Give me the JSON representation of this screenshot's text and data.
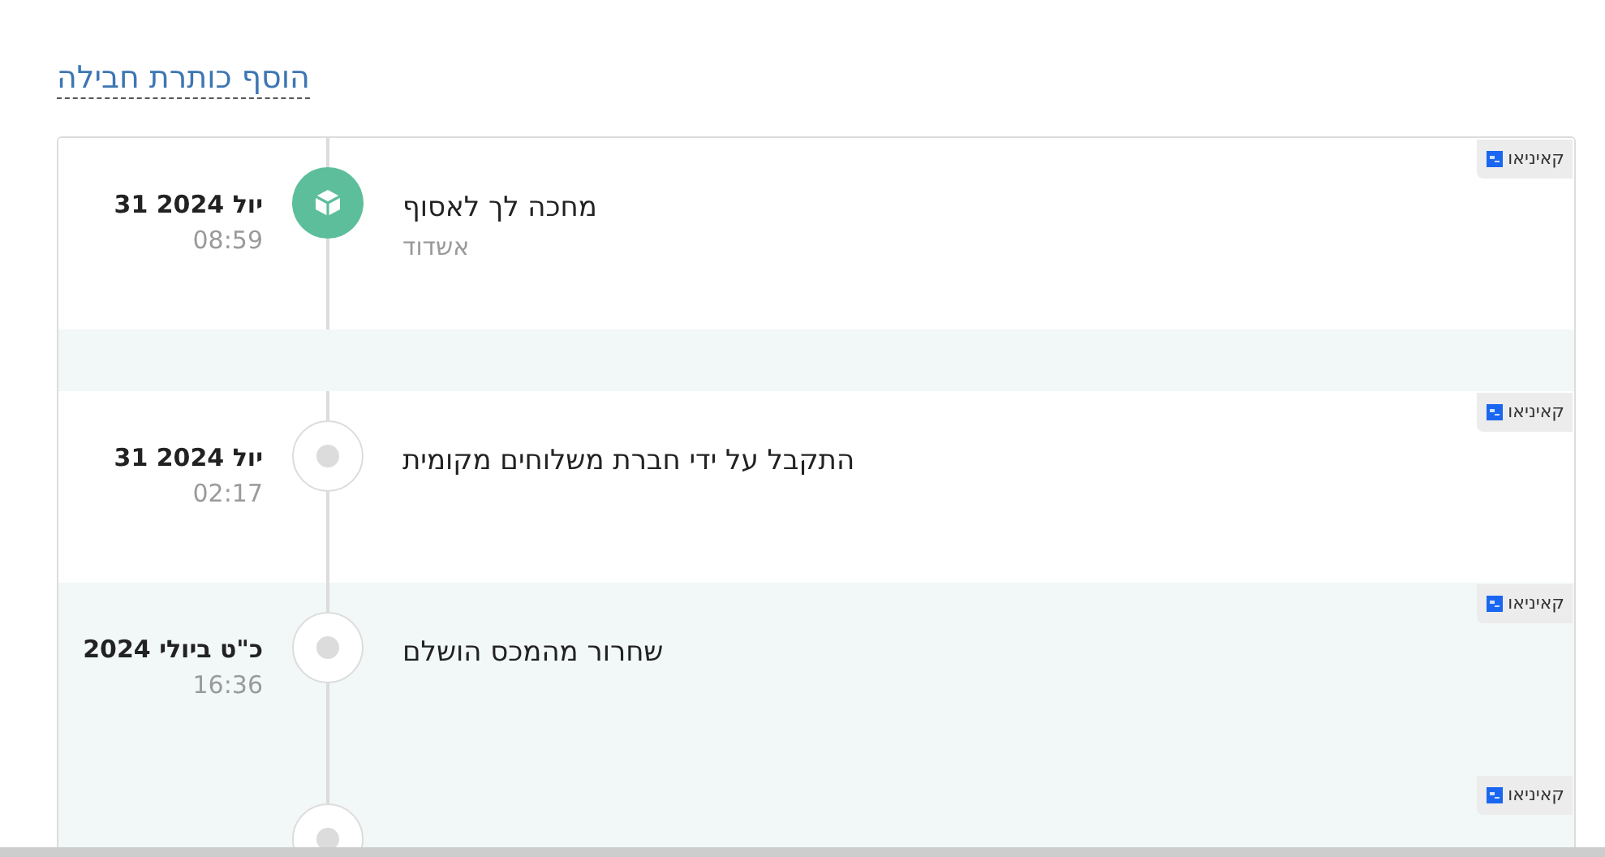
{
  "add_title_link": "הוסף כותרת חבילה",
  "events": [
    {
      "kind": "event",
      "shaded": false,
      "active": true,
      "date": "יול 2024 31",
      "time": "08:59",
      "title": "מחכה לך לאסוף",
      "location": "אשדוד",
      "carrier": "קאיניאו"
    },
    {
      "kind": "spacer",
      "shaded": true
    },
    {
      "kind": "event",
      "shaded": false,
      "active": false,
      "date": "יול 2024 31",
      "time": "02:17",
      "title": "התקבל על ידי חברת משלוחים מקומית",
      "carrier": "קאיניאו"
    },
    {
      "kind": "event",
      "shaded": true,
      "active": false,
      "date": "כ\"ט ביולי 2024",
      "time": "16:36",
      "title": "שחרור מהמכס הושלם",
      "carrier": "קאיניאו"
    },
    {
      "kind": "event",
      "shaded": true,
      "active": false,
      "carrier": "קאיניאו"
    }
  ]
}
